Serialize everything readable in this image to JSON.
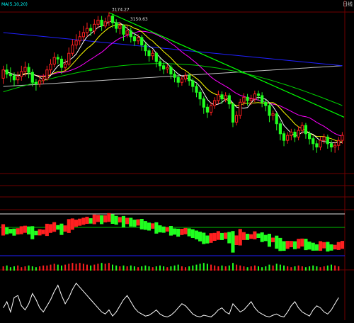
{
  "header": {
    "legend_text": "MA(5,10,20)",
    "corner_label": "日线"
  },
  "annotations": {
    "high_value": "3174.27",
    "ref_value": "3150.63"
  },
  "colors": {
    "background": "#000000",
    "up": "#ff2020",
    "down": "#20ff20",
    "ma5": "#ffffff",
    "ma10": "#ffff00",
    "ma20": "#ff00ff",
    "ma60": "#00d000",
    "ma120": "#2020ff",
    "ma250": "#c0c0c0",
    "trendline": "#00ff00",
    "grid_red": "#700000",
    "legend_text": "#00ffff"
  },
  "chart_data": {
    "type": "candlestick",
    "price_min": 2980,
    "price_max": 3185,
    "candles": [
      [
        3095,
        3105,
        3088,
        3110
      ],
      [
        3105,
        3100,
        3095,
        3112
      ],
      [
        3100,
        3098,
        3090,
        3108
      ],
      [
        3098,
        3093,
        3085,
        3102
      ],
      [
        3093,
        3097,
        3088,
        3103
      ],
      [
        3097,
        3103,
        3092,
        3110
      ],
      [
        3103,
        3108,
        3097,
        3115
      ],
      [
        3108,
        3102,
        3095,
        3113
      ],
      [
        3102,
        3090,
        3085,
        3106
      ],
      [
        3090,
        3088,
        3080,
        3094
      ],
      [
        3088,
        3092,
        3084,
        3098
      ],
      [
        3092,
        3094,
        3088,
        3100
      ],
      [
        3094,
        3105,
        3092,
        3110
      ],
      [
        3105,
        3112,
        3100,
        3118
      ],
      [
        3112,
        3120,
        3108,
        3126
      ],
      [
        3120,
        3118,
        3112,
        3124
      ],
      [
        3118,
        3108,
        3100,
        3122
      ],
      [
        3108,
        3112,
        3104,
        3118
      ],
      [
        3112,
        3125,
        3110,
        3132
      ],
      [
        3125,
        3135,
        3122,
        3142
      ],
      [
        3135,
        3140,
        3130,
        3148
      ],
      [
        3140,
        3145,
        3135,
        3152
      ],
      [
        3145,
        3150,
        3140,
        3158
      ],
      [
        3150,
        3155,
        3145,
        3162
      ],
      [
        3155,
        3152,
        3146,
        3160
      ],
      [
        3152,
        3160,
        3148,
        3166
      ],
      [
        3160,
        3165,
        3155,
        3170
      ],
      [
        3165,
        3158,
        3152,
        3170
      ],
      [
        3158,
        3163,
        3155,
        3168
      ],
      [
        3163,
        3170,
        3158,
        3174.27
      ],
      [
        3170,
        3162,
        3156,
        3173
      ],
      [
        3162,
        3155,
        3150,
        3166
      ],
      [
        3155,
        3158,
        3148,
        3163
      ],
      [
        3158,
        3148,
        3140,
        3160
      ],
      [
        3148,
        3152,
        3144,
        3158
      ],
      [
        3152,
        3145,
        3138,
        3156
      ],
      [
        3145,
        3140,
        3134,
        3150
      ],
      [
        3140,
        3144,
        3136,
        3148
      ],
      [
        3144,
        3135,
        3128,
        3147
      ],
      [
        3135,
        3128,
        3122,
        3138
      ],
      [
        3128,
        3122,
        3115,
        3131
      ],
      [
        3122,
        3125,
        3117,
        3129
      ],
      [
        3125,
        3115,
        3108,
        3127
      ],
      [
        3115,
        3110,
        3104,
        3119
      ],
      [
        3110,
        3106,
        3100,
        3114
      ],
      [
        3106,
        3108,
        3101,
        3112
      ],
      [
        3108,
        3100,
        3094,
        3111
      ],
      [
        3100,
        3096,
        3090,
        3104
      ],
      [
        3096,
        3090,
        3084,
        3099
      ],
      [
        3090,
        3094,
        3086,
        3098
      ],
      [
        3094,
        3098,
        3090,
        3102
      ],
      [
        3098,
        3092,
        3086,
        3101
      ],
      [
        3092,
        3085,
        3078,
        3095
      ],
      [
        3085,
        3078,
        3072,
        3088
      ],
      [
        3078,
        3070,
        3062,
        3081
      ],
      [
        3070,
        3060,
        3052,
        3073
      ],
      [
        3060,
        3054,
        3047,
        3064
      ],
      [
        3054,
        3062,
        3050,
        3066
      ],
      [
        3062,
        3068,
        3058,
        3072
      ],
      [
        3068,
        3075,
        3064,
        3080
      ],
      [
        3075,
        3070,
        3064,
        3079
      ],
      [
        3070,
        3074,
        3066,
        3078
      ],
      [
        3074,
        3064,
        3058,
        3077
      ],
      [
        3064,
        3042,
        3036,
        3066
      ],
      [
        3042,
        3050,
        3038,
        3055
      ],
      [
        3050,
        3066,
        3046,
        3070
      ],
      [
        3066,
        3072,
        3062,
        3077
      ],
      [
        3072,
        3068,
        3062,
        3076
      ],
      [
        3068,
        3070,
        3063,
        3075
      ],
      [
        3070,
        3076,
        3066,
        3080
      ],
      [
        3076,
        3074,
        3068,
        3080
      ],
      [
        3074,
        3066,
        3060,
        3078
      ],
      [
        3066,
        3062,
        3055,
        3069
      ],
      [
        3062,
        3050,
        3042,
        3065
      ],
      [
        3050,
        3052,
        3044,
        3056
      ],
      [
        3052,
        3040,
        3032,
        3054
      ],
      [
        3040,
        3028,
        3020,
        3043
      ],
      [
        3028,
        3020,
        3013,
        3031
      ],
      [
        3020,
        3026,
        3016,
        3030
      ],
      [
        3026,
        3030,
        3020,
        3034
      ],
      [
        3030,
        3024,
        3018,
        3034
      ],
      [
        3024,
        3032,
        3020,
        3037
      ],
      [
        3032,
        3038,
        3028,
        3042
      ],
      [
        3038,
        3028,
        3022,
        3041
      ],
      [
        3028,
        3022,
        3015,
        3031
      ],
      [
        3022,
        3016,
        3008,
        3025
      ],
      [
        3016,
        3012,
        3005,
        3020
      ],
      [
        3012,
        3020,
        3008,
        3024
      ],
      [
        3020,
        3024,
        3016,
        3028
      ],
      [
        3024,
        3016,
        3010,
        3027
      ],
      [
        3016,
        3012,
        3006,
        3020
      ],
      [
        3012,
        3014,
        3005,
        3018
      ],
      [
        3014,
        3020,
        3008,
        3024
      ],
      [
        3020,
        3026,
        3016,
        3030
      ]
    ],
    "volume": [
      5,
      6,
      4,
      5,
      6,
      4,
      5,
      6,
      5,
      4,
      5,
      6,
      6,
      7,
      8,
      7,
      6,
      7,
      8,
      9,
      8,
      9,
      8,
      7,
      6,
      7,
      8,
      9,
      8,
      9,
      7,
      6,
      5,
      6,
      5,
      6,
      5,
      4,
      5,
      6,
      5,
      4,
      5,
      6,
      5,
      4,
      5,
      6,
      7,
      5,
      4,
      5,
      6,
      7,
      8,
      9,
      8,
      7,
      6,
      5,
      6,
      5,
      6,
      9,
      7,
      6,
      5,
      4,
      5,
      6,
      5,
      4,
      5,
      7,
      6,
      8,
      7,
      6,
      5,
      4,
      5,
      6,
      5,
      4,
      5,
      6,
      5,
      4,
      5,
      6,
      7,
      6,
      5
    ],
    "lower_indicator": [
      30,
      45,
      20,
      55,
      60,
      35,
      25,
      40,
      65,
      50,
      30,
      20,
      35,
      50,
      70,
      85,
      60,
      40,
      55,
      75,
      90,
      80,
      70,
      60,
      50,
      40,
      30,
      20,
      15,
      25,
      10,
      20,
      35,
      50,
      60,
      45,
      30,
      20,
      15,
      10,
      12,
      18,
      25,
      15,
      10,
      8,
      12,
      20,
      30,
      40,
      35,
      25,
      15,
      10,
      8,
      12,
      10,
      8,
      15,
      25,
      30,
      20,
      15,
      40,
      30,
      20,
      25,
      35,
      45,
      30,
      20,
      15,
      10,
      8,
      12,
      15,
      10,
      8,
      20,
      35,
      45,
      30,
      20,
      15,
      10,
      25,
      35,
      30,
      20,
      15,
      25,
      40,
      55
    ],
    "lower_indicator_range": [
      0,
      100
    ]
  }
}
